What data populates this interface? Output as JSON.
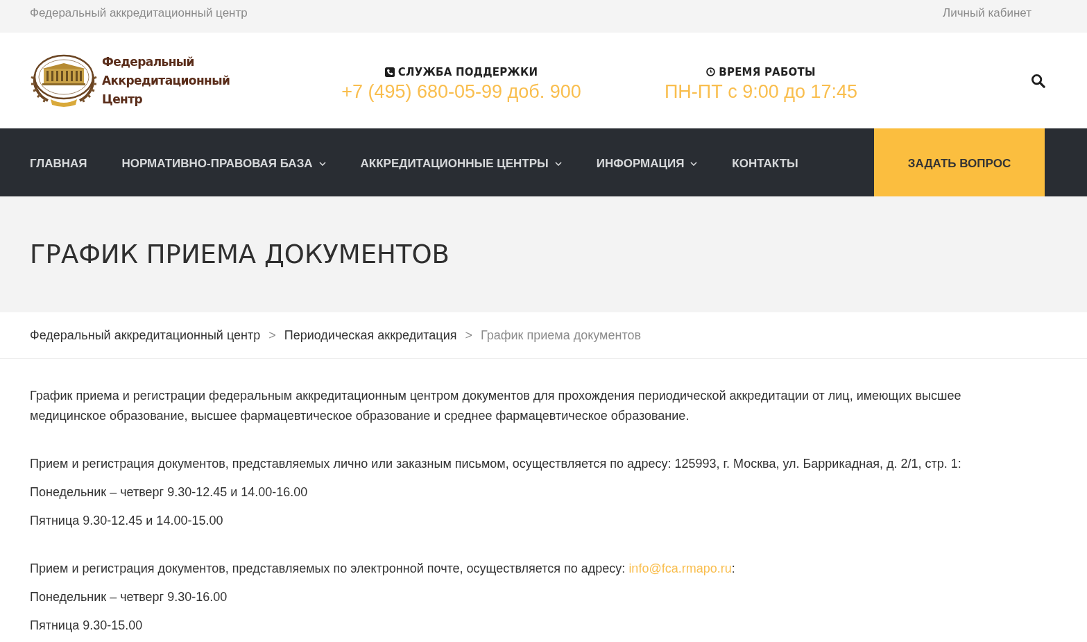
{
  "top_bar": {
    "site_link": "Федеральный аккредитационный центр",
    "account_link": "Личный кабинет"
  },
  "header": {
    "logo_lines": [
      "Федеральный",
      "Аккредитационный",
      "Центр"
    ],
    "support": {
      "label": "СЛУЖБА ПОДДЕРЖКИ",
      "value": "+7 (495) 680-05-99 доб. 900"
    },
    "hours": {
      "label": "ВРЕМЯ РАБОТЫ",
      "value": "ПН-ПТ с 9:00 до 17:45"
    }
  },
  "nav": {
    "items": [
      {
        "label": "ГЛАВНАЯ",
        "dropdown": false
      },
      {
        "label": "НОРМАТИВНО-ПРАВОВАЯ БАЗА",
        "dropdown": true
      },
      {
        "label": "АККРЕДИТАЦИОННЫЕ ЦЕНТРЫ",
        "dropdown": true
      },
      {
        "label": "ИНФОРМАЦИЯ",
        "dropdown": true
      },
      {
        "label": "КОНТАКТЫ",
        "dropdown": false
      }
    ],
    "ask_button": "ЗАДАТЬ ВОПРОС"
  },
  "page_title": "ГРАФИК ПРИЕМА ДОКУМЕНТОВ",
  "breadcrumbs": [
    {
      "label": "Федеральный аккредитационный центр",
      "current": false
    },
    {
      "label": "Периодическая аккредитация",
      "current": false
    },
    {
      "label": "График приема документов",
      "current": true
    }
  ],
  "breadcrumb_separators": [
    ">",
    ">"
  ],
  "content": [
    {
      "lines": [
        {
          "kind": "text",
          "text": "График приема и регистрации федеральным аккредитационным центром документов для прохождения периодической аккредитации от лиц, имеющих высшее медицинское образование, высшее фармацевтическое образование и среднее фармацевтическое образование."
        }
      ]
    },
    {
      "lines": [
        {
          "kind": "text",
          "text": "Прием и регистрация документов, представляемых лично или заказным письмом, осуществляется по адресу: 125993, г. Москва, ул. Баррикадная, д. 2/1, стр. 1:"
        },
        {
          "kind": "text",
          "text": "Понедельник – четверг 9.30-12.45 и 14.00-16.00"
        },
        {
          "kind": "text",
          "text": "Пятница 9.30-12.45 и 14.00-15.00"
        }
      ]
    },
    {
      "lines": [
        {
          "kind": "link",
          "text": "Прием и регистрация документов, представляемых по электронной почте, осуществляется по адресу:",
          "link": "info@fca.rmapo.ru",
          "tail": ":"
        },
        {
          "kind": "text",
          "text": "Понедельник – четверг 9.30-16.00"
        },
        {
          "kind": "text",
          "text": "Пятница 9.30-15.00"
        }
      ]
    }
  ]
}
